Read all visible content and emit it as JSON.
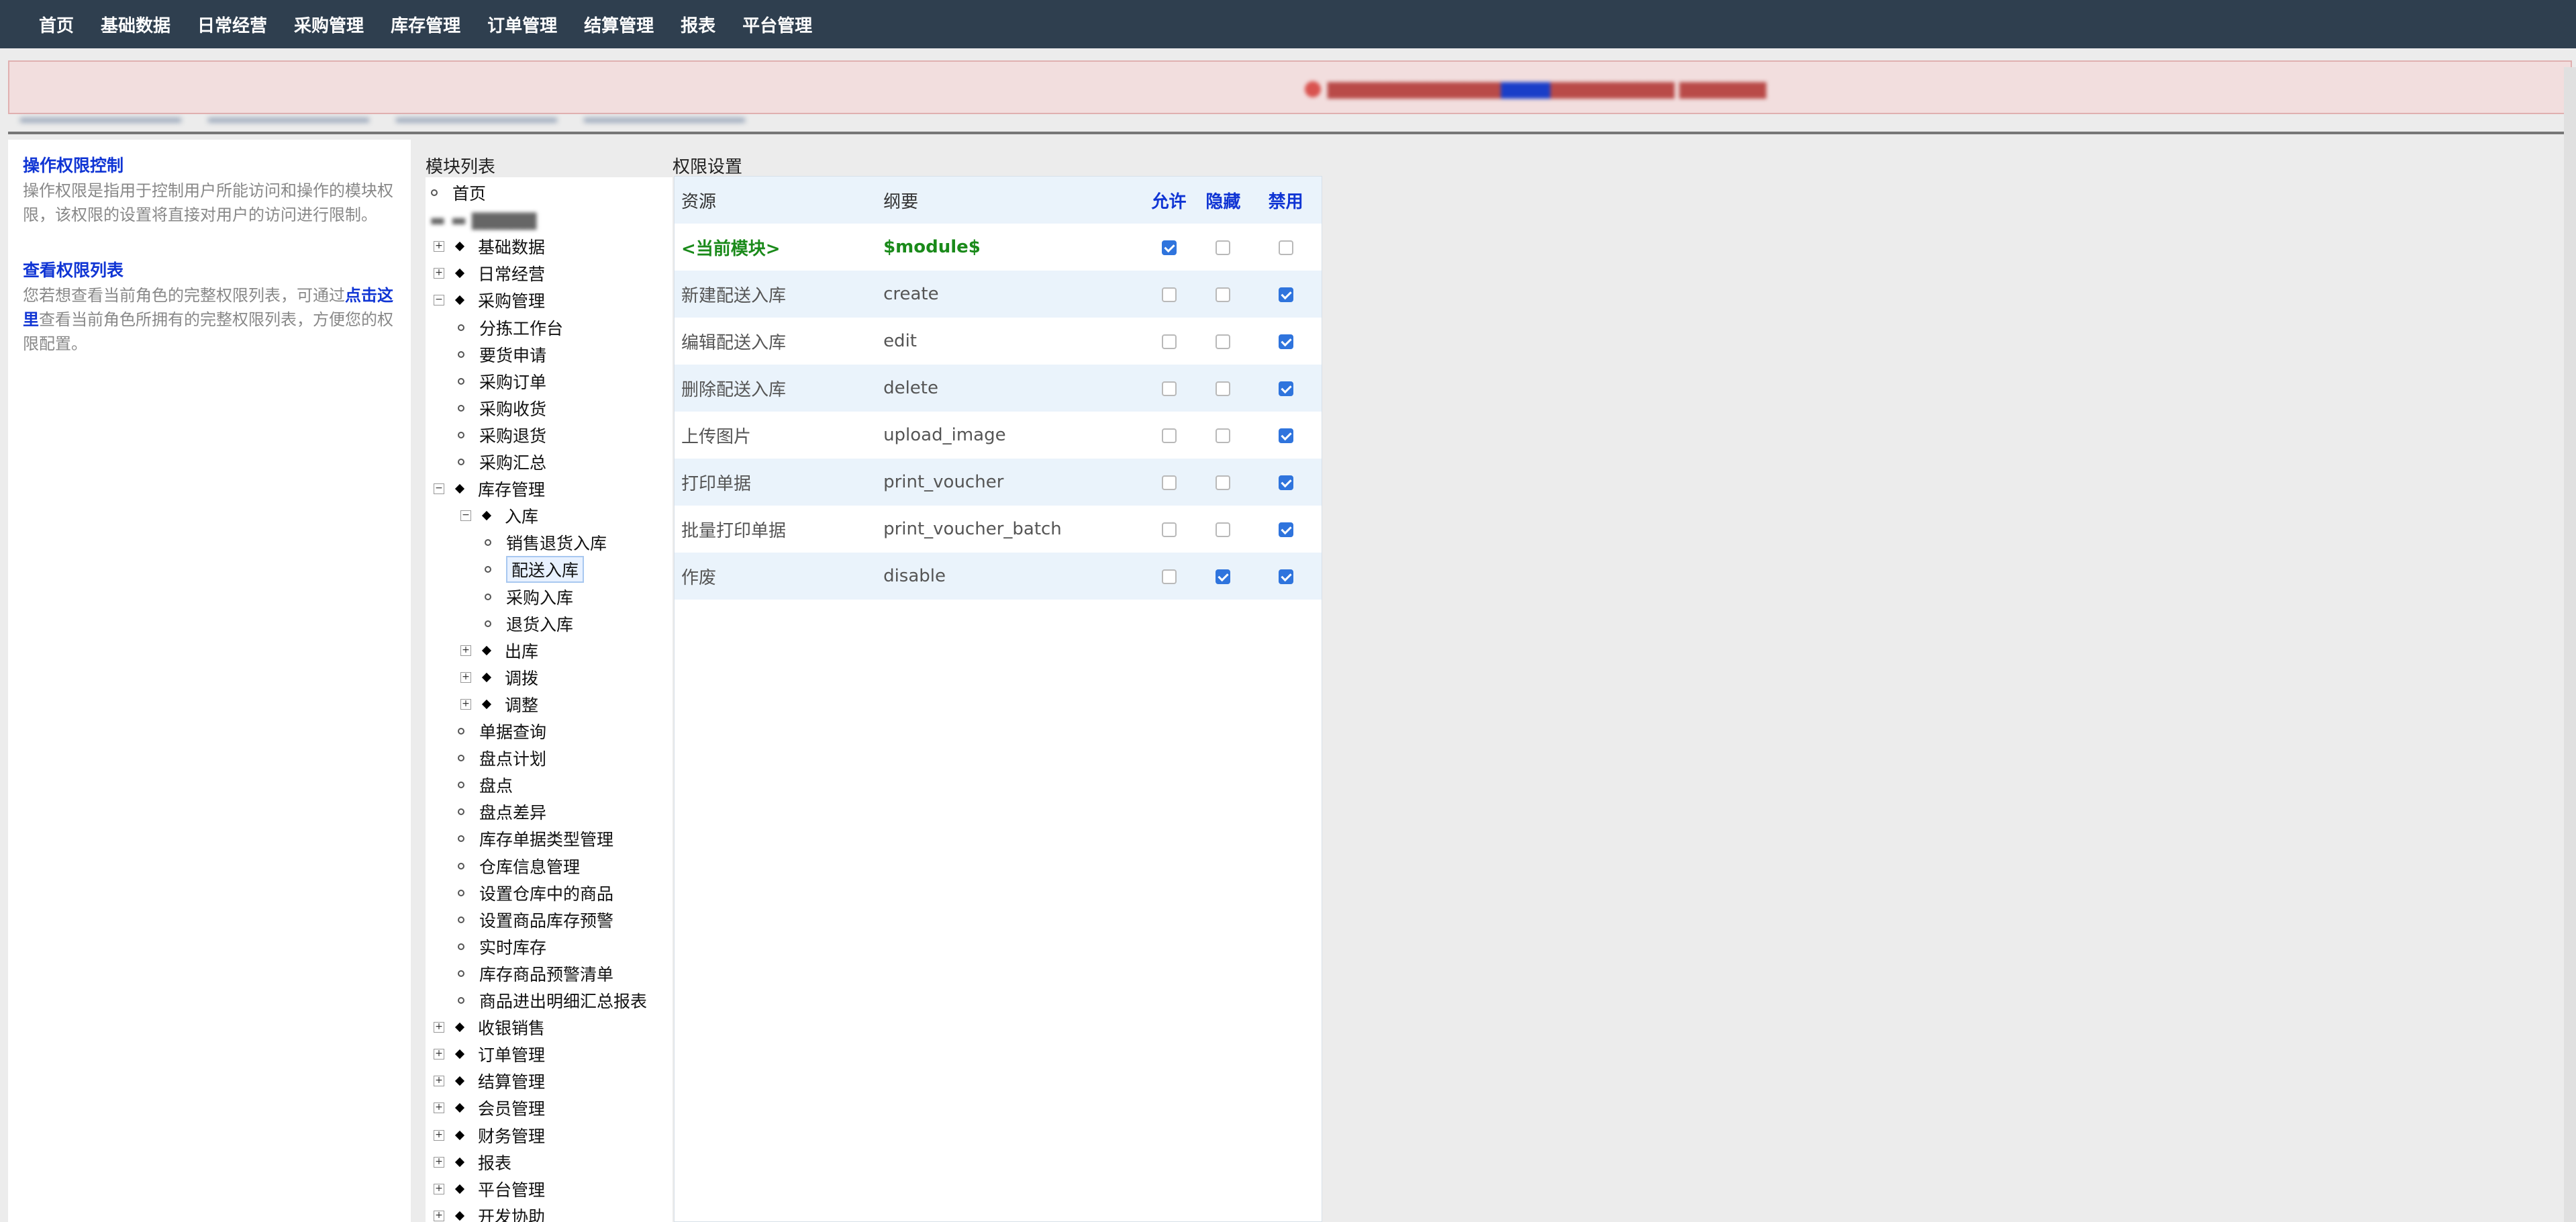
{
  "nav": {
    "items": [
      "首页",
      "基础数据",
      "日常经营",
      "采购管理",
      "库存管理",
      "订单管理",
      "结算管理",
      "报表",
      "平台管理"
    ]
  },
  "help": {
    "title1": "操作权限控制",
    "text1": "操作权限是指用于控制用户所能访问和操作的模块权限，该权限的设置将直接对用户的访问进行限制。",
    "title2": "查看权限列表",
    "text2_pre": "您若想查看当前角色的完整权限列表，可通过",
    "text2_link": "点击这里",
    "text2_post": "查看当前角色所拥有的完整权限列表，方便您的权限配置。"
  },
  "tree": {
    "header": "模块列表",
    "items": [
      {
        "label": "首页",
        "level": 1,
        "type": "leaf"
      },
      {
        "label": "基础数据",
        "level": 0,
        "type": "collapsed"
      },
      {
        "label": "日常经营",
        "level": 0,
        "type": "collapsed"
      },
      {
        "label": "采购管理",
        "level": 0,
        "type": "expanded"
      },
      {
        "label": "分拣工作台",
        "level": 2,
        "type": "leaf"
      },
      {
        "label": "要货申请",
        "level": 2,
        "type": "leaf"
      },
      {
        "label": "采购订单",
        "level": 2,
        "type": "leaf"
      },
      {
        "label": "采购收货",
        "level": 2,
        "type": "leaf"
      },
      {
        "label": "采购退货",
        "level": 2,
        "type": "leaf"
      },
      {
        "label": "采购汇总",
        "level": 2,
        "type": "leaf"
      },
      {
        "label": "库存管理",
        "level": 0,
        "type": "expanded"
      },
      {
        "label": "入库",
        "level": 1,
        "type": "expanded"
      },
      {
        "label": "销售退货入库",
        "level": 3,
        "type": "leaf"
      },
      {
        "label": "配送入库",
        "level": 3,
        "type": "leaf",
        "selected": true
      },
      {
        "label": "采购入库",
        "level": 3,
        "type": "leaf"
      },
      {
        "label": "退货入库",
        "level": 3,
        "type": "leaf"
      },
      {
        "label": "出库",
        "level": 1,
        "type": "collapsed"
      },
      {
        "label": "调拨",
        "level": 1,
        "type": "collapsed"
      },
      {
        "label": "调整",
        "level": 1,
        "type": "collapsed"
      },
      {
        "label": "单据查询",
        "level": 2,
        "type": "leaf"
      },
      {
        "label": "盘点计划",
        "level": 2,
        "type": "leaf"
      },
      {
        "label": "盘点",
        "level": 2,
        "type": "leaf"
      },
      {
        "label": "盘点差异",
        "level": 2,
        "type": "leaf"
      },
      {
        "label": "库存单据类型管理",
        "level": 2,
        "type": "leaf"
      },
      {
        "label": "仓库信息管理",
        "level": 2,
        "type": "leaf"
      },
      {
        "label": "设置仓库中的商品",
        "level": 2,
        "type": "leaf"
      },
      {
        "label": "设置商品库存预警",
        "level": 2,
        "type": "leaf"
      },
      {
        "label": "实时库存",
        "level": 2,
        "type": "leaf"
      },
      {
        "label": "库存商品预警清单",
        "level": 2,
        "type": "leaf"
      },
      {
        "label": "商品进出明细汇总报表",
        "level": 2,
        "type": "leaf"
      },
      {
        "label": "收银销售",
        "level": 0,
        "type": "collapsed"
      },
      {
        "label": "订单管理",
        "level": 0,
        "type": "collapsed"
      },
      {
        "label": "结算管理",
        "level": 0,
        "type": "collapsed"
      },
      {
        "label": "会员管理",
        "level": 0,
        "type": "collapsed"
      },
      {
        "label": "财务管理",
        "level": 0,
        "type": "collapsed"
      },
      {
        "label": "报表",
        "level": 0,
        "type": "collapsed"
      },
      {
        "label": "平台管理",
        "level": 0,
        "type": "collapsed"
      },
      {
        "label": "开发协助",
        "level": 0,
        "type": "collapsed"
      }
    ]
  },
  "perm": {
    "header": "权限设置",
    "columns": {
      "resource": "资源",
      "summary": "纲要",
      "allow": "允许",
      "hide": "隐藏",
      "deny": "禁用"
    },
    "rows": [
      {
        "resource": "<当前模块>",
        "summary": "$module$",
        "allow": true,
        "hide": false,
        "deny": false,
        "current": true
      },
      {
        "resource": "新建配送入库",
        "summary": "create",
        "allow": false,
        "hide": false,
        "deny": true
      },
      {
        "resource": "编辑配送入库",
        "summary": "edit",
        "allow": false,
        "hide": false,
        "deny": true
      },
      {
        "resource": "删除配送入库",
        "summary": "delete",
        "allow": false,
        "hide": false,
        "deny": true
      },
      {
        "resource": "上传图片",
        "summary": "upload_image",
        "allow": false,
        "hide": false,
        "deny": true
      },
      {
        "resource": "打印单据",
        "summary": "print_voucher",
        "allow": false,
        "hide": false,
        "deny": true
      },
      {
        "resource": "批量打印单据",
        "summary": "print_voucher_batch",
        "allow": false,
        "hide": false,
        "deny": true
      },
      {
        "resource": "作废",
        "summary": "disable",
        "allow": false,
        "hide": true,
        "deny": true
      }
    ]
  },
  "colors": {
    "nav_bg": "#2f3f4f",
    "accent": "#1035d4",
    "banner_bg": "#f2dede",
    "current_module": "#1a8a1a",
    "checkbox_on": "#2f74dd"
  }
}
